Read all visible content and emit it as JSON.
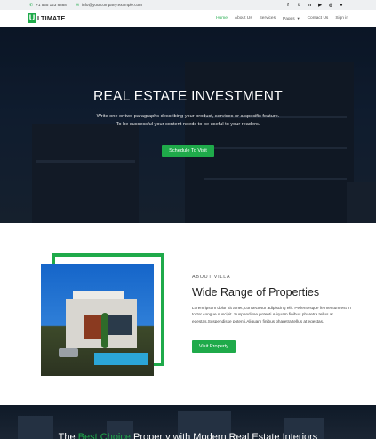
{
  "topbar": {
    "phone": "+1 555 123 8888",
    "email": "info@yourcompany.example.com",
    "social_icons": [
      "facebook-icon",
      "twitter-icon",
      "linkedin-icon",
      "youtube-icon",
      "instagram-icon",
      "github-icon"
    ]
  },
  "nav": {
    "logo_letter": "U",
    "logo_text": "LTIMATE",
    "items": [
      {
        "label": "Home",
        "active": true
      },
      {
        "label": "About Us",
        "active": false
      },
      {
        "label": "Services",
        "active": false
      },
      {
        "label": "Pages",
        "active": false,
        "dropdown": true
      },
      {
        "label": "Contact Us",
        "active": false
      },
      {
        "label": "Sign in",
        "active": false
      }
    ]
  },
  "hero": {
    "title": "REAL ESTATE INVESTMENT",
    "line1": "Write one or two paragraphs describing your product, services or a specific feature.",
    "line2": "To be successful your content needs to be useful to your readers.",
    "cta": "Schedule To Visit"
  },
  "about": {
    "eyebrow": "ABOUT VILLA",
    "title": "Wide Range of Properties",
    "body": "Lorem ipsum dolor sit amet, consectetur adipiscing elit. Pellentesque fermentum est in tortor congue suscipit. Suspendisse potenti.Aliquam finibus pharetra tellus at egestas.Suspendisse potenti.Aliquam finibus pharetra tellus at egestas.",
    "cta": "Visit Property"
  },
  "banner": {
    "pre": "The ",
    "highlight": "Best Choice",
    "post": " Property with Modern Real Estate Interiors"
  },
  "colors": {
    "accent": "#1faa4a",
    "topbar_bg": "#eef0f2",
    "hero_dark": "#0d1a2c"
  }
}
